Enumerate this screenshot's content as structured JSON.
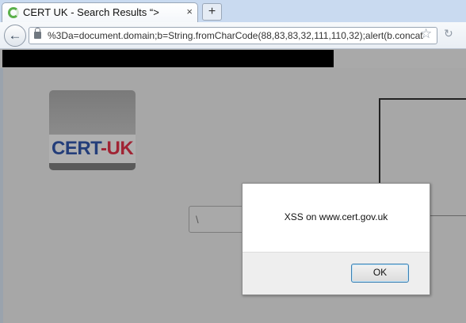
{
  "browser": {
    "tab_title": "CERT UK - Search Results “>",
    "tab_close_glyph": "×",
    "new_tab_glyph": "+",
    "back_glyph": "←",
    "url": "%3Da=document.domain;b=String.fromCharCode(88,83,83,32,111,110,32);alert(b.concat",
    "star_glyph": "☆",
    "reload_glyph": "↻",
    "icons": {
      "favicon": "loading-spinner-icon",
      "lock": "lock-icon",
      "star": "star-icon",
      "reload": "reload-icon",
      "back": "back-arrow-icon"
    }
  },
  "page": {
    "logo": {
      "part1": "CERT",
      "dash": "-",
      "part2": "UK"
    },
    "search_text": "\\"
  },
  "dialog": {
    "message": "XSS on www.cert.gov.uk",
    "ok_label": "OK"
  },
  "colors": {
    "logo_blue": "#243e7a",
    "logo_red": "#a02434",
    "ok_border": "#3c7fb1"
  }
}
